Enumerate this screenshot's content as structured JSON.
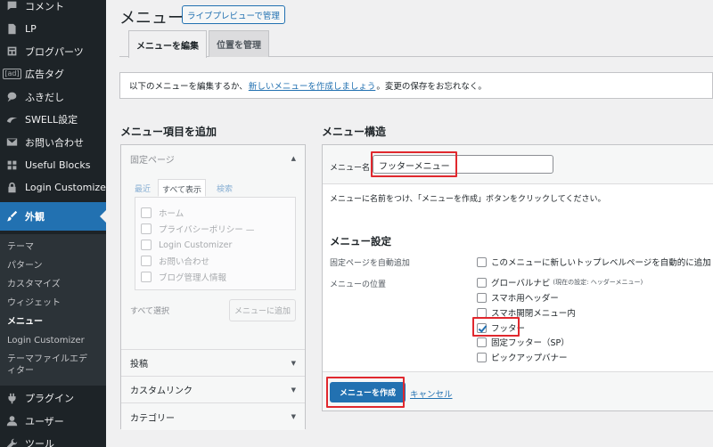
{
  "sidebar": {
    "items_top": [
      {
        "label": "コメント",
        "icon": "comment-icon"
      },
      {
        "label": "LP",
        "icon": "document-icon"
      },
      {
        "label": "ブログパーツ",
        "icon": "blocks-icon"
      },
      {
        "label": "広告タグ",
        "icon": "ad-icon",
        "icon_text": "[ad]"
      },
      {
        "label": "ふきだし",
        "icon": "speech-bubble-icon"
      },
      {
        "label": "SWELL設定",
        "icon": "swell-icon"
      },
      {
        "label": "お問い合わせ",
        "icon": "mail-icon"
      },
      {
        "label": "Useful Blocks",
        "icon": "grid-icon"
      },
      {
        "label": "Login Customizer",
        "icon": "lock-icon"
      }
    ],
    "active_item": {
      "label": "外観",
      "icon": "brush-icon"
    },
    "submenu": [
      {
        "label": "テーマ"
      },
      {
        "label": "パターン"
      },
      {
        "label": "カスタマイズ"
      },
      {
        "label": "ウィジェット"
      },
      {
        "label": "メニュー",
        "current": true
      },
      {
        "label": "Login Customizer"
      },
      {
        "label": "テーマファイルエディター"
      }
    ],
    "items_bottom": [
      {
        "label": "プラグイン",
        "icon": "plugin-icon"
      },
      {
        "label": "ユーザー",
        "icon": "user-icon"
      },
      {
        "label": "ツール",
        "icon": "wrench-icon"
      }
    ]
  },
  "header": {
    "title": "メニュー",
    "live_preview_label": "ライブプレビューで管理"
  },
  "tabs": [
    {
      "label": "メニューを編集",
      "active": true
    },
    {
      "label": "位置を管理",
      "active": false
    }
  ],
  "notice": {
    "before": "以下のメニューを編集するか、",
    "link": "新しいメニューを作成しましょう",
    "after": "。変更の保存をお忘れなく。"
  },
  "add_items": {
    "heading": "メニュー項目を追加",
    "fixed_page": {
      "title": "固定ページ",
      "inner_tabs": [
        "最近",
        "すべて表示",
        "検索"
      ],
      "active_inner_tab": "すべて表示",
      "pages": [
        "ホーム",
        "プライバシーポリシー —",
        "Login Customizer",
        "お問い合わせ",
        "ブログ管理人情報"
      ],
      "select_all": "すべて選択",
      "add_button": "メニューに追加"
    },
    "collapsed_sections": [
      "投稿",
      "カスタムリンク",
      "カテゴリー"
    ]
  },
  "structure": {
    "heading": "メニュー構造",
    "name_label": "メニュー名",
    "name_value": "フッターメニュー",
    "instruction": "メニューに名前をつけ、「メニューを作成」ボタンをクリックしてください。",
    "settings_heading": "メニュー設定",
    "auto_add_label": "固定ページを自動追加",
    "auto_add_option": "このメニューに新しいトップレベルページを自動的に追加",
    "location_label": "メニューの位置",
    "locations": [
      {
        "label": "グローバルナビ",
        "note": "(現在の設定: ヘッダーメニュー)",
        "checked": false
      },
      {
        "label": "スマホ用ヘッダー",
        "note": "",
        "checked": false
      },
      {
        "label": "スマホ開閉メニュー内",
        "note": "",
        "checked": false
      },
      {
        "label": "フッター",
        "note": "",
        "checked": true
      },
      {
        "label": "固定フッター（SP）",
        "note": "",
        "checked": false
      },
      {
        "label": "ピックアップバナー",
        "note": "",
        "checked": false
      }
    ],
    "create_button": "メニューを作成",
    "cancel_link": "キャンセル"
  },
  "colors": {
    "accent": "#2271b1",
    "sidebar_bg": "#1d2327",
    "highlight_red": "#e0282e"
  }
}
